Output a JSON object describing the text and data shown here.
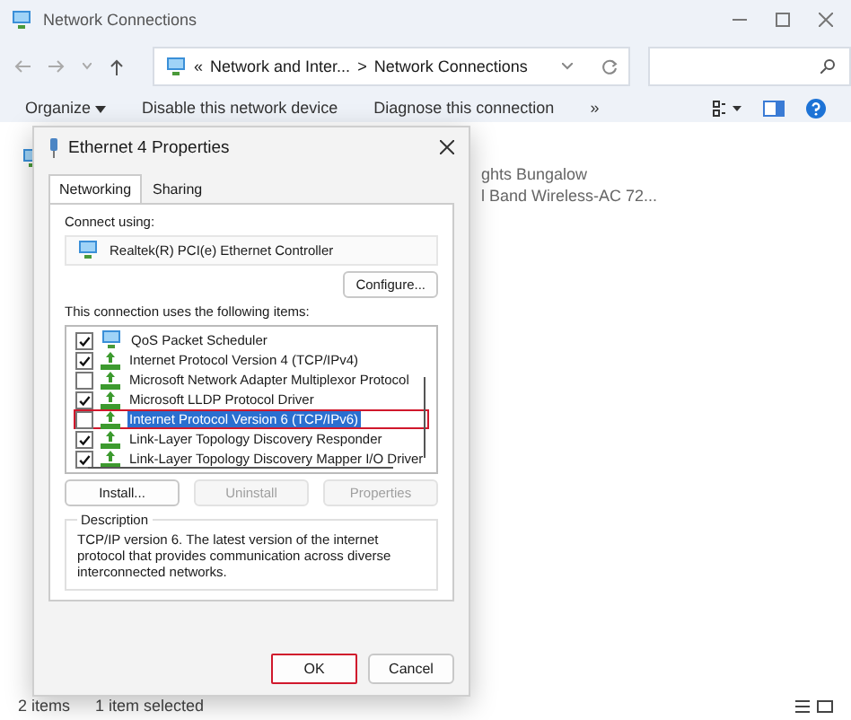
{
  "window": {
    "title": "Network Connections"
  },
  "address": {
    "prefix": "«",
    "segments": [
      "Network and Inter...",
      "Network Connections"
    ],
    "separator": ">"
  },
  "toolbar": {
    "items": [
      {
        "label": "Organize",
        "dropdown": true
      },
      {
        "label": "Disable this network device",
        "dropdown": false
      },
      {
        "label": "Diagnose this connection",
        "dropdown": false
      }
    ],
    "more": "»"
  },
  "connections": [
    {
      "name": "ghts Bungalow",
      "detail": "l Band Wireless-AC 72..."
    }
  ],
  "dialog": {
    "title": "Ethernet 4 Properties",
    "tabs": [
      {
        "label": "Networking",
        "selected": true
      },
      {
        "label": "Sharing",
        "selected": false
      }
    ],
    "connect_label": "Connect using:",
    "adapter": "Realtek(R) PCI(e) Ethernet Controller",
    "configure": "Configure...",
    "items_label": "This connection uses the following items:",
    "items": [
      {
        "label": "QoS Packet Scheduler",
        "kind": "service",
        "checked": true,
        "selected": false,
        "annotated": false
      },
      {
        "label": "Internet Protocol Version 4 (TCP/IPv4)",
        "kind": "protocol",
        "checked": true,
        "selected": false,
        "annotated": false
      },
      {
        "label": "Microsoft Network Adapter Multiplexor Protocol",
        "kind": "protocol",
        "checked": false,
        "selected": false,
        "annotated": false
      },
      {
        "label": "Microsoft LLDP Protocol Driver",
        "kind": "protocol",
        "checked": true,
        "selected": false,
        "annotated": false
      },
      {
        "label": "Internet Protocol Version 6 (TCP/IPv6)",
        "kind": "protocol",
        "checked": false,
        "selected": true,
        "annotated": true
      },
      {
        "label": "Link-Layer Topology Discovery Responder",
        "kind": "protocol",
        "checked": true,
        "selected": false,
        "annotated": false
      },
      {
        "label": "Link-Layer Topology Discovery Mapper I/O Driver",
        "kind": "protocol",
        "checked": true,
        "selected": false,
        "annotated": false
      }
    ],
    "item_buttons": [
      {
        "label": "Install...",
        "disabled": false
      },
      {
        "label": "Uninstall",
        "disabled": true
      },
      {
        "label": "Properties",
        "disabled": true
      }
    ],
    "description": {
      "title": "Description",
      "text": "TCP/IP version 6. The latest version of the internet protocol that provides communication across diverse interconnected networks."
    },
    "buttons": [
      {
        "label": "OK",
        "annotated": true
      },
      {
        "label": "Cancel",
        "annotated": false
      }
    ]
  },
  "status_bar": [
    "2 items",
    "1 item selected"
  ]
}
